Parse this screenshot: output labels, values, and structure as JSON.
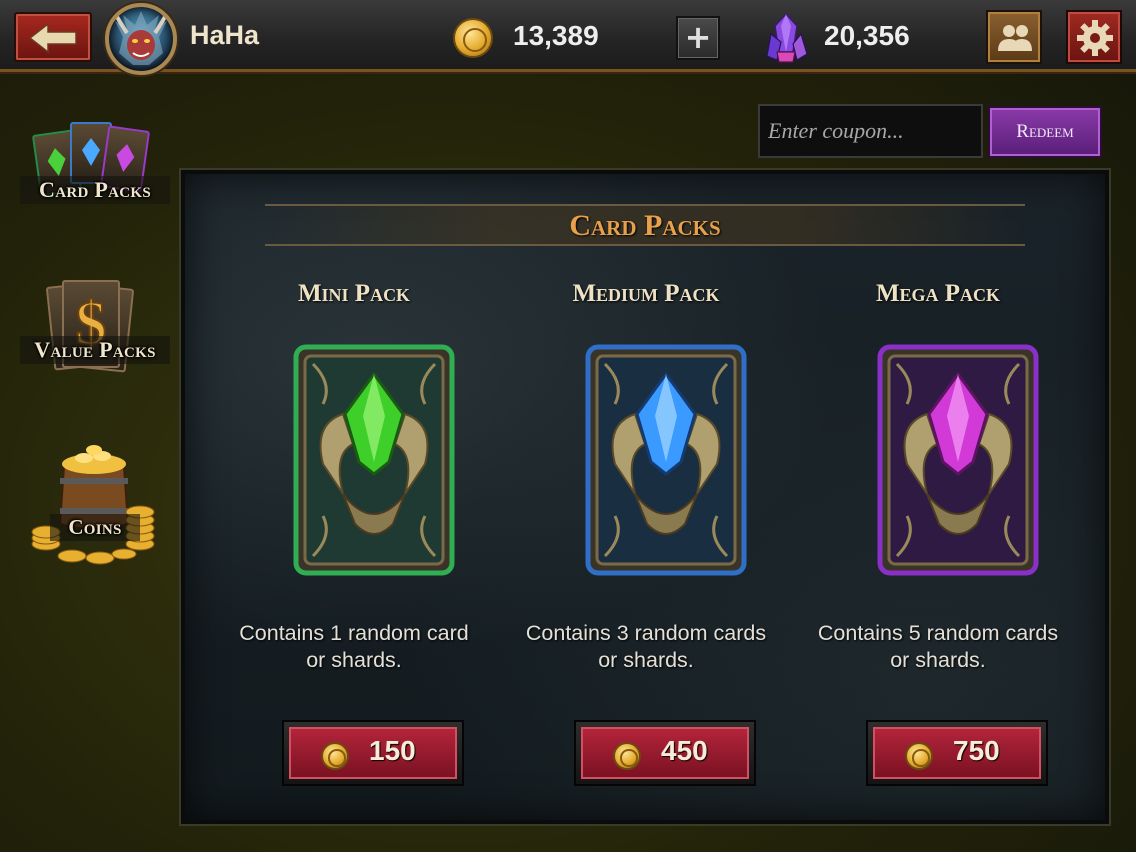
{
  "header": {
    "player_name": "HaHa",
    "gold": "13,389",
    "gems": "20,356",
    "icons": [
      "back-arrow-icon",
      "coin-icon",
      "plus-icon",
      "gem-icon",
      "friends-icon",
      "gear-icon"
    ]
  },
  "sidebar": {
    "items": [
      {
        "label": "Card Packs",
        "icon": "card-packs-icon",
        "selected": true
      },
      {
        "label": "Value Packs",
        "icon": "dollar-cards-icon",
        "selected": false
      },
      {
        "label": "Coins",
        "icon": "coin-barrel-icon",
        "selected": false
      }
    ]
  },
  "coupon": {
    "placeholder": "Enter coupon...",
    "redeem_label": "Redeem"
  },
  "panel": {
    "title": "Card Packs",
    "packs": [
      {
        "name": "Mini Pack",
        "desc_line1": "Contains 1 random card",
        "desc_line2": "or shards.",
        "price": "150",
        "gem_color": "#3ecf2a",
        "frame_color": "#2fae54"
      },
      {
        "name": "Medium Pack",
        "desc_line1": "Contains 3 random cards",
        "desc_line2": "or shards.",
        "price": "450",
        "gem_color": "#3a9aff",
        "frame_color": "#2f6fc8"
      },
      {
        "name": "Mega Pack",
        "desc_line1": "Contains 5 random cards",
        "desc_line2": "or shards.",
        "price": "750",
        "gem_color": "#d23ad8",
        "frame_color": "#8a2fc8"
      }
    ]
  },
  "colors": {
    "accent_gold": "#e8a04a",
    "buy_button_red": "#b3243a",
    "redeem_purple": "#8a3aa8"
  }
}
